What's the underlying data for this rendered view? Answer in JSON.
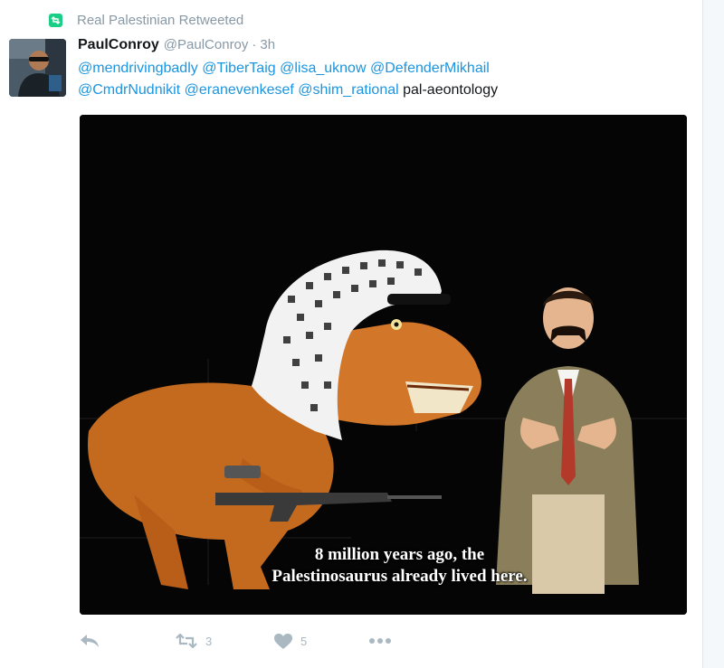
{
  "retweet_context": {
    "text": "Real Palestinian Retweeted",
    "icon": "retweet-icon",
    "color": "#19cf86"
  },
  "tweet": {
    "author_name": "PaulConroy",
    "author_handle": "@PaulConroy",
    "separator": "·",
    "timestamp": "3h",
    "mentions": [
      "@mendrivingbadly",
      "@TiberTaig",
      "@lisa_uknow",
      "@DefenderMikhail",
      "@CmdrNudnikit",
      "@eranevenkesef",
      "@shim_rational"
    ],
    "body_text": "pal-aeontology",
    "link_color": "#1b95e0",
    "media": {
      "caption_line1": "8 million years ago, the",
      "caption_line2": "Palestinosaurus already lived here."
    }
  },
  "actions": {
    "reply": {
      "icon": "reply-icon"
    },
    "retweet": {
      "icon": "retweet-icon",
      "count": "3"
    },
    "like": {
      "icon": "heart-icon",
      "count": "5"
    },
    "more": {
      "icon": "more-icon"
    }
  }
}
